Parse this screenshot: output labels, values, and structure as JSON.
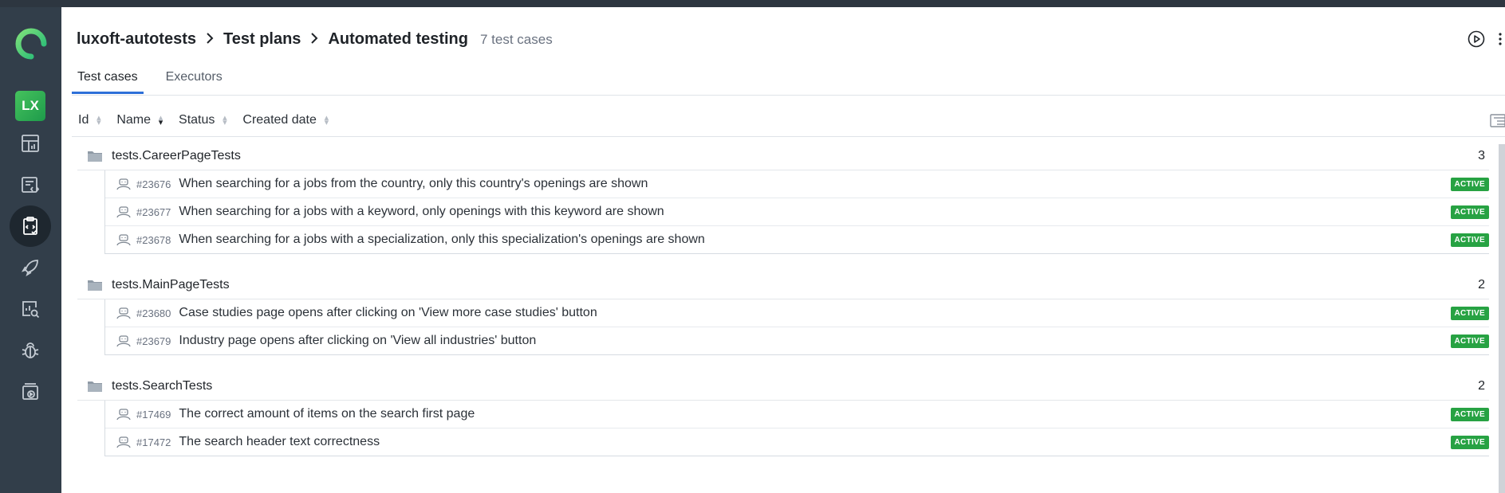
{
  "sidebar": {
    "avatar_initials": "LX",
    "nav_items": [
      "dashboards-icon",
      "test-cases-icon",
      "test-plans-icon",
      "launches-icon",
      "analytics-icon",
      "defects-icon",
      "jobs-icon"
    ],
    "active_item": "test-plans-icon"
  },
  "header": {
    "breadcrumb": [
      "luxoft-autotests",
      "Test plans",
      "Automated testing"
    ],
    "count_text": "7 test cases"
  },
  "tabs": [
    "Test cases",
    "Executors"
  ],
  "columns": [
    "Id",
    "Name",
    "Status",
    "Created date"
  ],
  "groups": [
    {
      "name": "tests.CareerPageTests",
      "count": "3",
      "cases": [
        {
          "id": "#23676",
          "title": "When searching for a jobs from the country, only this country's openings are shown",
          "status": "ACTIVE"
        },
        {
          "id": "#23677",
          "title": "When searching for a jobs with a keyword, only openings with this keyword are shown",
          "status": "ACTIVE"
        },
        {
          "id": "#23678",
          "title": "When searching for a jobs with a specialization, only this specialization's openings are shown",
          "status": "ACTIVE"
        }
      ]
    },
    {
      "name": "tests.MainPageTests",
      "count": "2",
      "cases": [
        {
          "id": "#23680",
          "title": "Case studies page opens after clicking on 'View more case studies' button",
          "status": "ACTIVE"
        },
        {
          "id": "#23679",
          "title": "Industry page opens after clicking on 'View all industries' button",
          "status": "ACTIVE"
        }
      ]
    },
    {
      "name": "tests.SearchTests",
      "count": "2",
      "cases": [
        {
          "id": "#17469",
          "title": "The correct amount of items on the search first page",
          "status": "ACTIVE"
        },
        {
          "id": "#17472",
          "title": "The search header text correctness",
          "status": "ACTIVE"
        }
      ]
    }
  ],
  "colors": {
    "sidebar_bg": "#323e4a",
    "accent": "#2d6fd8",
    "active_badge": "#27a243",
    "brand": "#3ecf6e"
  }
}
